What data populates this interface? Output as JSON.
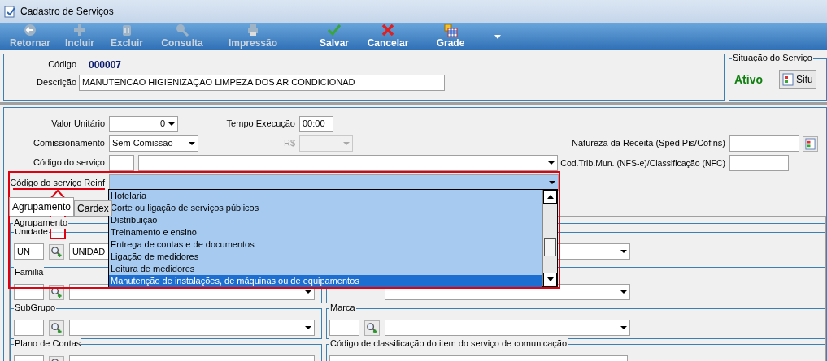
{
  "window": {
    "title": "Cadastro de Serviços"
  },
  "toolbar": [
    {
      "label": "Retornar",
      "kind": "back",
      "disabled": true
    },
    {
      "label": "Incluir",
      "kind": "add",
      "disabled": true
    },
    {
      "label": "Excluir",
      "kind": "delete",
      "disabled": true
    },
    {
      "label": "Consulta",
      "kind": "search",
      "disabled": true
    },
    {
      "label": "Impressão",
      "kind": "print",
      "disabled": true
    },
    {
      "label": "Salvar",
      "kind": "save",
      "disabled": false
    },
    {
      "label": "Cancelar",
      "kind": "cancel",
      "disabled": false
    },
    {
      "label": "Grade",
      "kind": "grid",
      "disabled": false
    }
  ],
  "header": {
    "code_label": "Código",
    "code": "000007",
    "description_label": "Descrição",
    "description": "MANUTENCAO HIGIENIZAÇAO LIMPEZA DOS AR CONDICIONAD"
  },
  "status": {
    "legend": "Situação do Serviço",
    "value": "Ativo",
    "button": "Situ"
  },
  "form": {
    "unit_value": {
      "label": "Valor Unitário",
      "value": "0"
    },
    "exec_time": {
      "label": "Tempo Execução",
      "value": "00:00"
    },
    "commission": {
      "label": "Comissionamento",
      "value": "Sem Comissão"
    },
    "commission_value": {
      "label": "R$",
      "disabled": true
    },
    "revenue_nature": {
      "label": "Natureza da Receita (Sped Pis/Cofins)"
    },
    "service_code": {
      "label": "Código do serviço"
    },
    "municipal_code": {
      "label": "Cod.Trib.Mun. (NFS-e)/Classificação (NFC)"
    },
    "reinf_code": {
      "label": "Código do serviço Reinf",
      "expanded": true,
      "options": [
        {
          "label": "Hotelaria",
          "selected": false
        },
        {
          "label": "Corte ou ligação de serviços públicos",
          "selected": false
        },
        {
          "label": "Distribuição",
          "selected": false
        },
        {
          "label": "Treinamento e ensino",
          "selected": false
        },
        {
          "label": "Entrega de contas e de documentos",
          "selected": false
        },
        {
          "label": "Ligação de medidores",
          "selected": false
        },
        {
          "label": "Leitura de medidores",
          "selected": false
        },
        {
          "label": "Manutenção de instalações, de máquinas ou de equipamentos",
          "selected": true
        }
      ]
    }
  },
  "tabs": [
    {
      "label": "Agrupamento",
      "selected": true
    },
    {
      "label": "Cardex",
      "selected": false
    }
  ],
  "group": {
    "legend": "Agrupamento",
    "left": [
      {
        "legend": "Unidade",
        "kind": "lookup",
        "code": "UN",
        "value": "UNIDAD"
      },
      {
        "legend": "Familia",
        "kind": "lookup"
      },
      {
        "legend": "SubGrupo",
        "kind": "lookup"
      },
      {
        "legend": "Plano de Contas",
        "kind": "lookup"
      }
    ],
    "right": [
      {
        "kind": "partial"
      },
      {
        "kind": "partial"
      },
      {
        "legend": "Marca",
        "kind": "lookup"
      },
      {
        "legend": "Código de classificação do item do serviço de comunicação",
        "kind": "select"
      }
    ]
  }
}
